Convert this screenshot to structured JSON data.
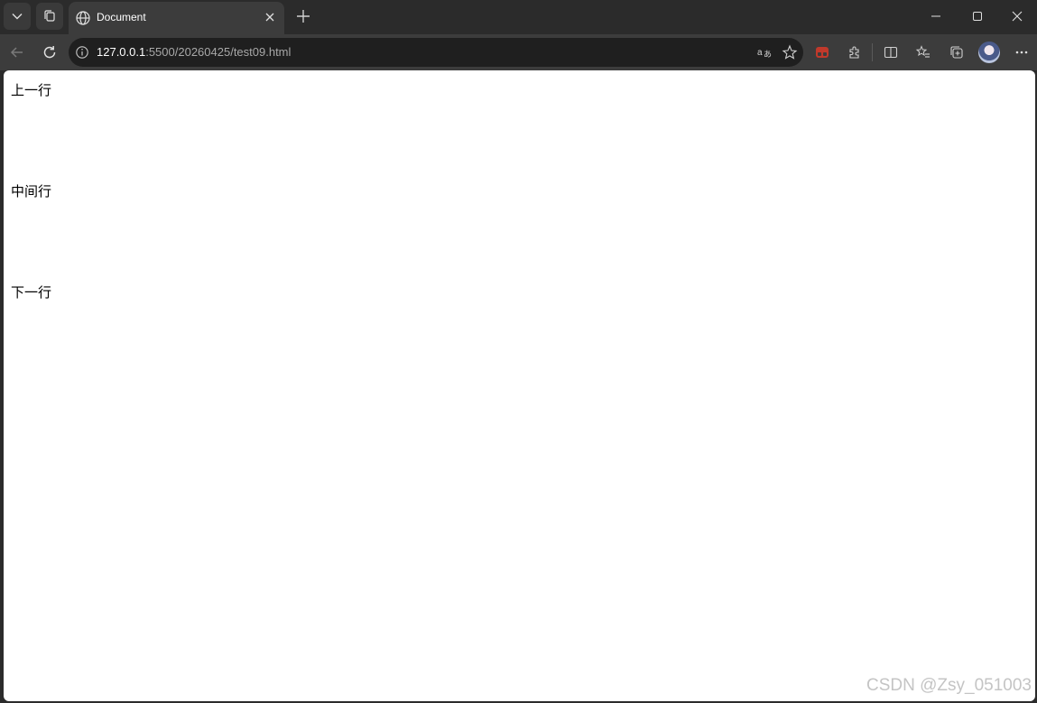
{
  "tab": {
    "title": "Document",
    "favicon": "globe-icon"
  },
  "address_bar": {
    "url_host": "127.0.0.1",
    "url_rest": ":5500/20260425/test09.html"
  },
  "page": {
    "lines": [
      "上一行",
      "中间行",
      "下一行"
    ]
  },
  "watermark": "CSDN @Zsy_051003",
  "colors": {
    "frame": "#2b2b2b",
    "toolbar": "#3c3c3c",
    "omnibox": "#1f1f1f",
    "page_bg": "#ffffff",
    "extension_accent": "#c0392b"
  }
}
